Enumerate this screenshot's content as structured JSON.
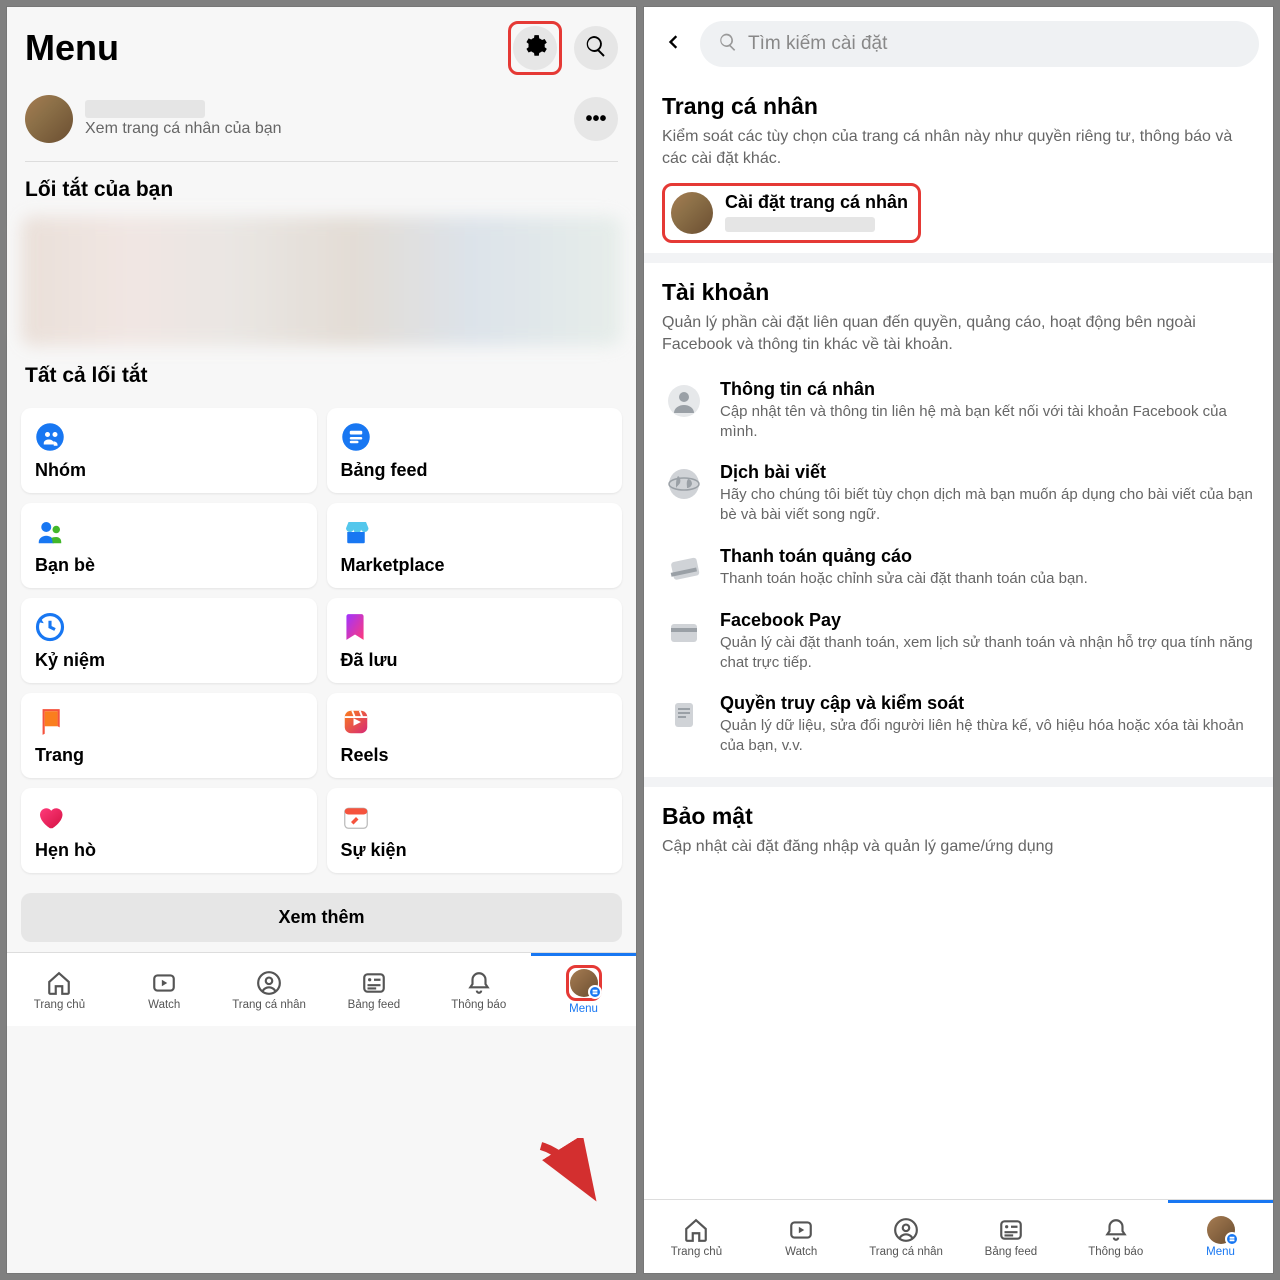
{
  "left": {
    "title": "Menu",
    "profile_sub": "Xem trang cá nhân của bạn",
    "shortcuts_label": "Lối tắt của bạn",
    "all_shortcuts_label": "Tất cả lối tắt",
    "tiles": [
      {
        "label": "Nhóm",
        "icon": "groups"
      },
      {
        "label": "Bảng feed",
        "icon": "feed"
      },
      {
        "label": "Bạn bè",
        "icon": "friends"
      },
      {
        "label": "Marketplace",
        "icon": "marketplace"
      },
      {
        "label": "Kỷ niệm",
        "icon": "memories"
      },
      {
        "label": "Đã lưu",
        "icon": "saved"
      },
      {
        "label": "Trang",
        "icon": "pages"
      },
      {
        "label": "Reels",
        "icon": "reels"
      },
      {
        "label": "Hẹn hò",
        "icon": "dating"
      },
      {
        "label": "Sự kiện",
        "icon": "events"
      }
    ],
    "see_more": "Xem thêm",
    "tabs": [
      {
        "label": "Trang chủ",
        "icon": "home"
      },
      {
        "label": "Watch",
        "icon": "watch"
      },
      {
        "label": "Trang cá nhân",
        "icon": "profile"
      },
      {
        "label": "Bảng feed",
        "icon": "feed"
      },
      {
        "label": "Thông báo",
        "icon": "bell"
      },
      {
        "label": "Menu",
        "icon": "menu",
        "active": true
      }
    ]
  },
  "right": {
    "search_placeholder": "Tìm kiếm cài đặt",
    "sections": [
      {
        "title": "Trang cá nhân",
        "desc": "Kiểm soát các tùy chọn của trang cá nhân này như quyền riêng tư, thông báo và các cài đặt khác.",
        "profile_settings_label": "Cài đặt trang cá nhân"
      },
      {
        "title": "Tài khoản",
        "desc": "Quản lý phần cài đặt liên quan đến quyền, quảng cáo, hoạt động bên ngoài Facebook và thông tin khác về tài khoản.",
        "options": [
          {
            "title": "Thông tin cá nhân",
            "desc": "Cập nhật tên và thông tin liên hệ mà bạn kết nối với tài khoản Facebook của mình.",
            "icon": "user"
          },
          {
            "title": "Dịch bài viết",
            "desc": "Hãy cho chúng tôi biết tùy chọn dịch mà bạn muốn áp dụng cho bài viết của bạn bè và bài viết song ngữ.",
            "icon": "globe"
          },
          {
            "title": "Thanh toán quảng cáo",
            "desc": "Thanh toán hoặc chỉnh sửa cài đặt thanh toán của bạn.",
            "icon": "card"
          },
          {
            "title": "Facebook Pay",
            "desc": "Quản lý cài đặt thanh toán, xem lịch sử thanh toán và nhận hỗ trợ qua tính năng chat trực tiếp.",
            "icon": "pay"
          },
          {
            "title": "Quyền truy cập và kiểm soát",
            "desc": "Quản lý dữ liệu, sửa đổi người liên hệ thừa kế, vô hiệu hóa hoặc xóa tài khoản của bạn, v.v.",
            "icon": "doc"
          }
        ]
      },
      {
        "title": "Bảo mật",
        "desc": "Cập nhật cài đặt đăng nhập và quản lý game/ứng dụng"
      }
    ],
    "tabs": [
      {
        "label": "Trang chủ",
        "icon": "home"
      },
      {
        "label": "Watch",
        "icon": "watch"
      },
      {
        "label": "Trang cá nhân",
        "icon": "profile"
      },
      {
        "label": "Bảng feed",
        "icon": "feed"
      },
      {
        "label": "Thông báo",
        "icon": "bell"
      },
      {
        "label": "Menu",
        "icon": "menu",
        "active": true
      }
    ]
  }
}
